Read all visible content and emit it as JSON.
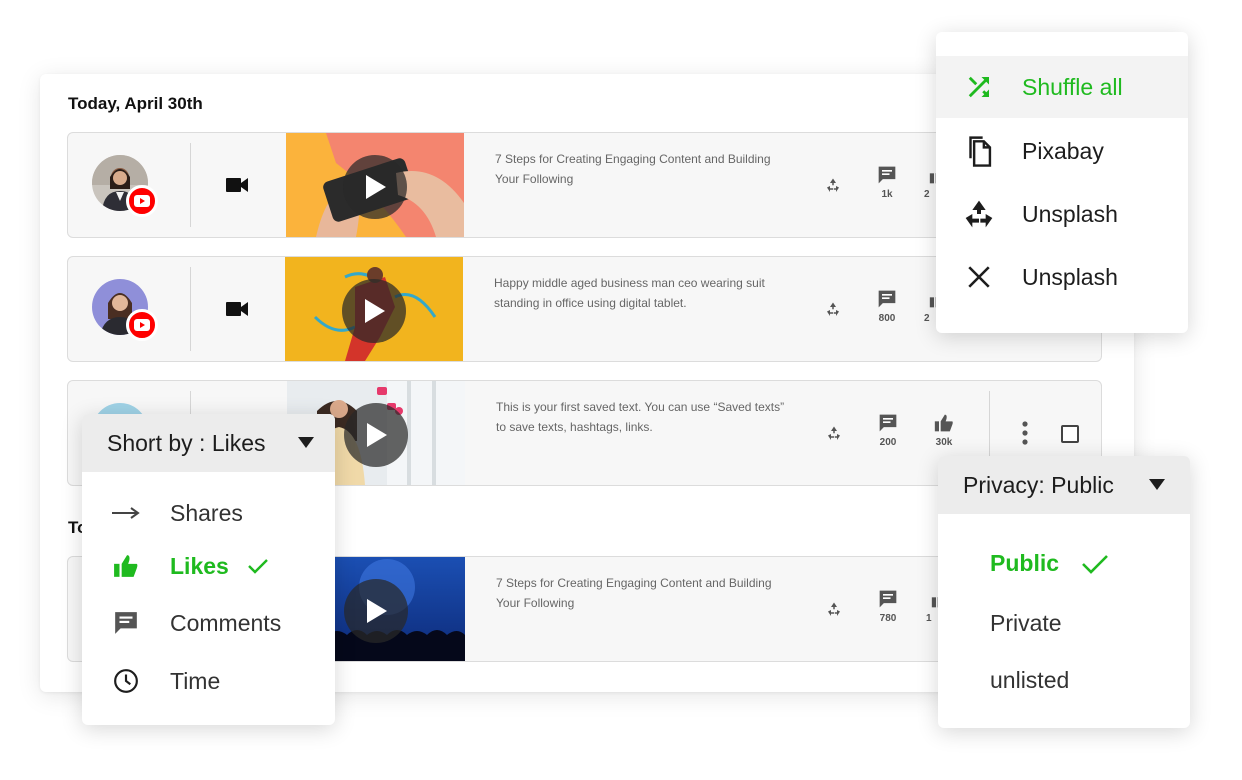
{
  "main": {
    "section1_date": "Today, April 30th",
    "section2_date": "To"
  },
  "posts": [
    {
      "text": "7 Steps for Creating Engaging Content and Building Your Following",
      "comments": "1k",
      "likes": "2",
      "platform_icon": "youtube-icon",
      "media_icon": "video-camera-icon"
    },
    {
      "text": "Happy middle aged business man ceo wearing suit standing in office using digital tablet.",
      "comments": "800",
      "likes": "2",
      "platform_icon": "youtube-icon",
      "media_icon": "video-camera-icon"
    },
    {
      "text": "This is your first saved text. You can use “Saved texts” to save texts, hashtags, links.",
      "comments": "200",
      "likes": "30k"
    },
    {
      "text": "7 Steps for Creating Engaging Content and Building Your Following",
      "comments": "780",
      "likes": "1"
    }
  ],
  "image_source_menu": {
    "items": [
      {
        "label": "Shuffle all",
        "icon": "shuffle-icon",
        "active": true
      },
      {
        "label": "Pixabay",
        "icon": "copy-icon"
      },
      {
        "label": "Unsplash",
        "icon": "recycle-icon"
      },
      {
        "label": "Unsplash",
        "icon": "close-icon"
      }
    ]
  },
  "sort_menu": {
    "header": "Short by : Likes",
    "items": [
      {
        "label": "Shares",
        "icon": "arrow-right-icon"
      },
      {
        "label": "Likes",
        "icon": "thumbs-up-icon",
        "active": true
      },
      {
        "label": "Comments",
        "icon": "comment-icon"
      },
      {
        "label": "Time",
        "icon": "clock-icon"
      }
    ]
  },
  "privacy_menu": {
    "header": "Privacy: Public",
    "options": [
      "Public",
      "Private",
      "unlisted"
    ],
    "selected": "Public"
  },
  "colors": {
    "accent_green": "#1fba1f",
    "youtube_red": "#ff0000"
  }
}
